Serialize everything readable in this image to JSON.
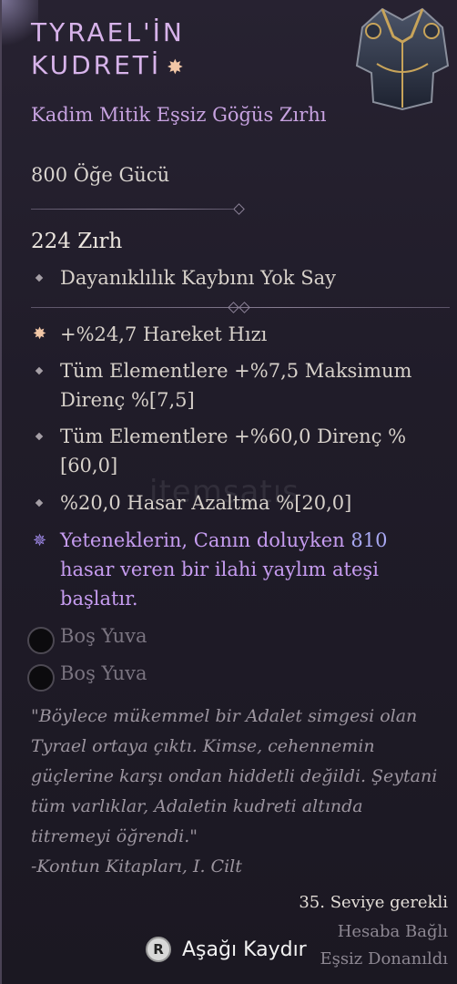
{
  "item": {
    "name": "TYRAEL'İN KUDRETİ",
    "type": "Kadim Mitik Eşsiz Göğüs Zırhı",
    "power": "800 Öğe Gücü",
    "armor": "224 Zırh",
    "implicit": "Dayanıklılık Kaybını Yok Say",
    "affixes": [
      {
        "text": "+%24,7 Hareket Hızı",
        "kind": "greater"
      },
      {
        "text": "Tüm Elementlere +%7,5 Maksimum Direnç %[7,5]",
        "kind": "normal"
      },
      {
        "text": "Tüm Elementlere +%60,0 Direnç %[60,0]",
        "kind": "normal"
      },
      {
        "text": "%20,0 Hasar Azaltma %[20,0]",
        "kind": "normal"
      }
    ],
    "unique_power": {
      "before": "Yeteneklerin, Canın doluyken ",
      "value": "810",
      "after": " hasar veren bir ilahi yaylım ateşi başlatır."
    },
    "sockets": [
      "Boş Yuva",
      "Boş Yuva"
    ],
    "flavor": "\"Böylece mükemmel bir Adalet simgesi olan Tyrael ortaya çıktı. Kimse, cehennemin güçlerine karşı ondan hiddetli değildi. Şeytani tüm varlıklar, Adaletin kudreti altında titremeyi öğrendi.\"",
    "flavor_source": "-Kontun Kitapları, I. Cilt",
    "requirements": [
      "35. Seviye gerekli",
      "Hesaba Bağlı",
      "Eşsiz Donanıldı"
    ]
  },
  "controls": {
    "scroll_key": "R",
    "scroll_label": "Aşağı Kaydır"
  },
  "watermark": "itemsatış",
  "colors": {
    "title": "#d7b3ea",
    "unique_text": "#c69cf0",
    "number": "#a8a8f2",
    "background": "#221e2b"
  },
  "icons": {
    "mythic": "mythic-star-icon",
    "greater_affix": "greater-affix-star-icon",
    "unique_power": "unique-power-icon",
    "socket": "empty-socket-icon",
    "scroll_key": "r-key-icon"
  }
}
